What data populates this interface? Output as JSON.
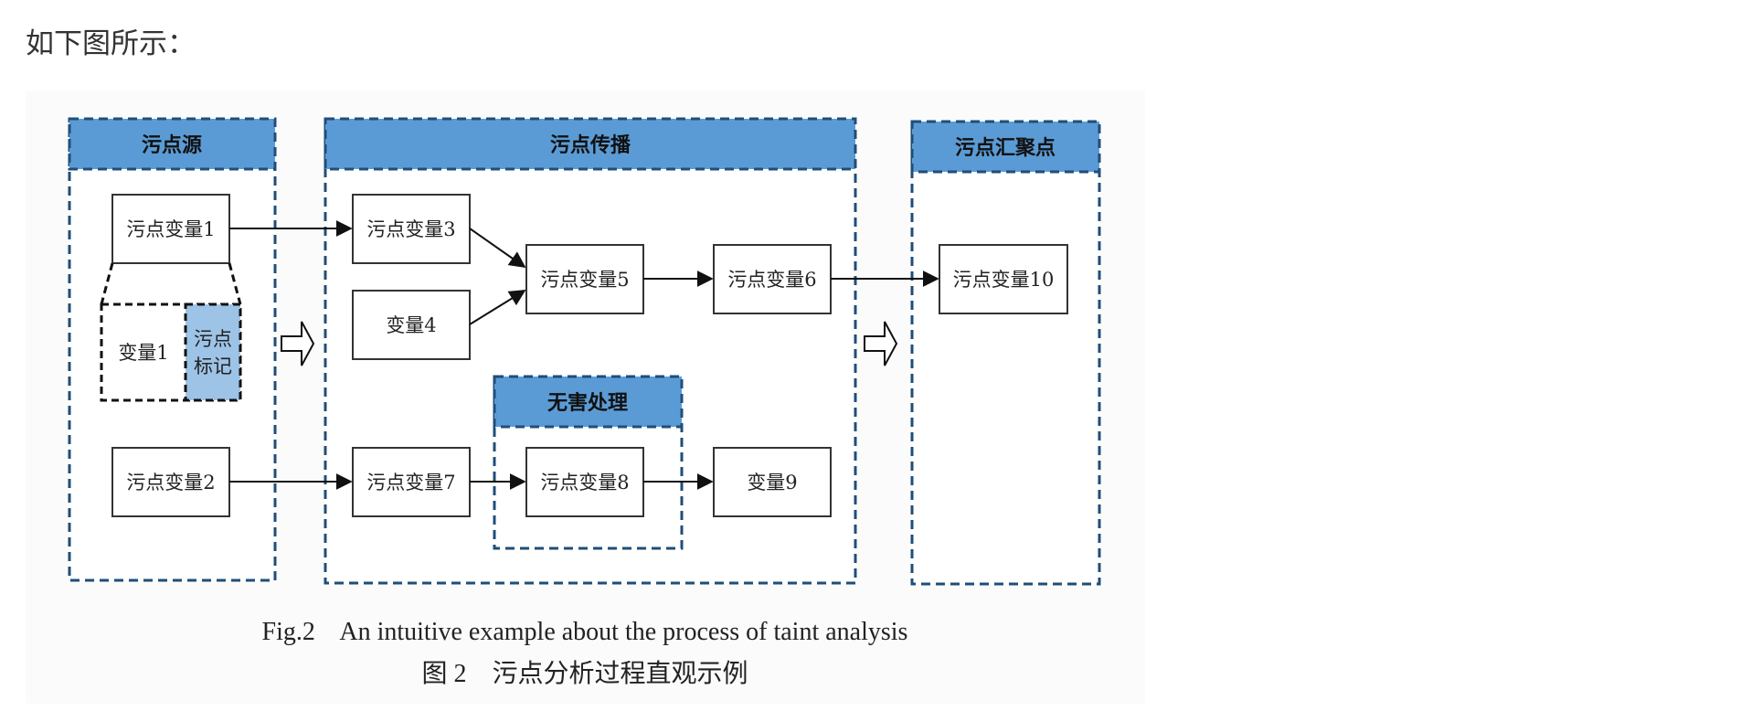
{
  "intro_text": "如下图所示：",
  "panels": {
    "source": "污点源",
    "propagation": "污点传播",
    "sink": "污点汇聚点",
    "sanitize": "无害处理"
  },
  "nodes": {
    "v1": "污点变量1",
    "var1": "变量1",
    "mark_line1": "污点",
    "mark_line2": "标记",
    "v2": "污点变量2",
    "v3": "污点变量3",
    "v4": "变量4",
    "v5": "污点变量5",
    "v6": "污点变量6",
    "v7": "污点变量7",
    "v8": "污点变量8",
    "v9": "变量9",
    "v10": "污点变量10"
  },
  "caption": {
    "en": "Fig.2    An intuitive example about the process of taint analysis",
    "zh": "图 2    污点分析过程直观示例"
  },
  "colors": {
    "header_fill": "#5b9bd5",
    "border": "#1f4e79",
    "mark_fill": "#9dc3e6"
  }
}
